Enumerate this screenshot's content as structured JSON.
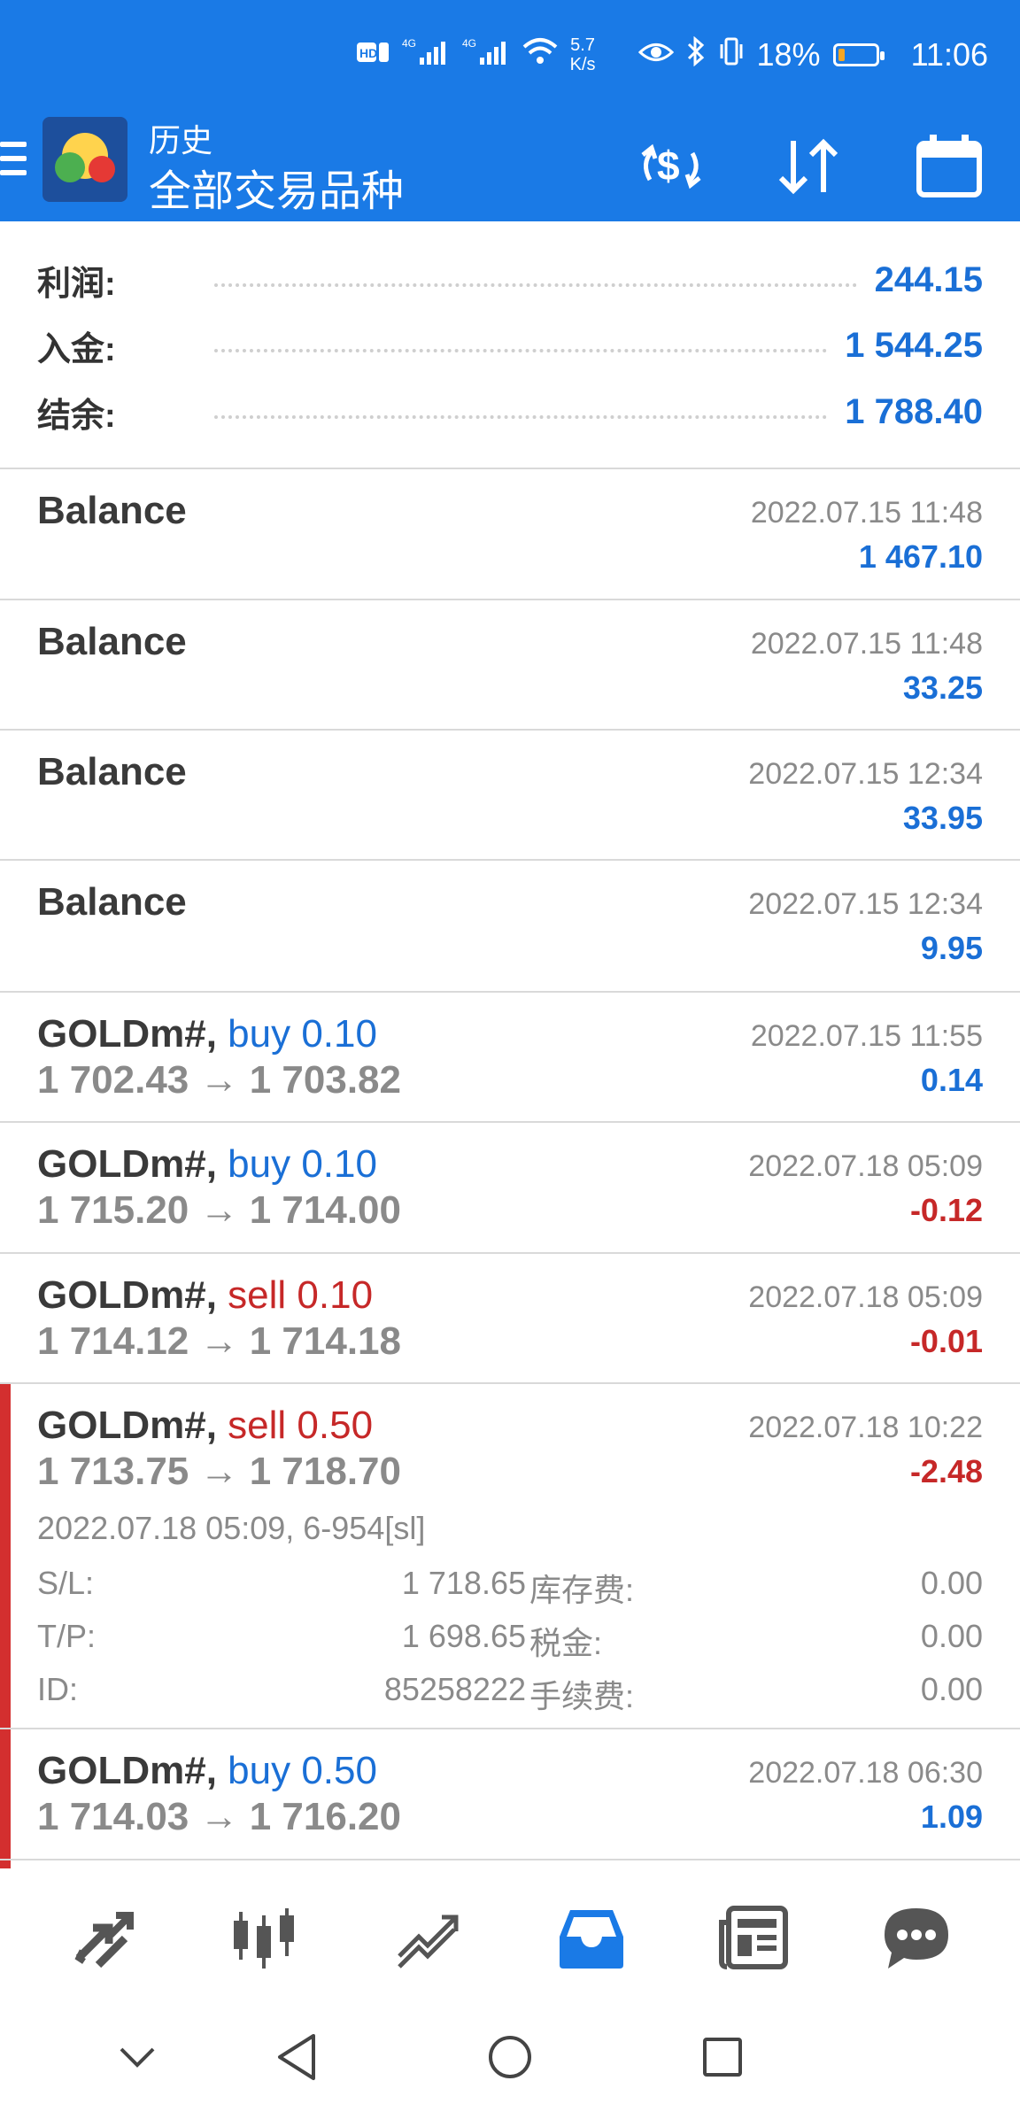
{
  "status_bar": {
    "network_speed": "5.7\nK/s",
    "battery_percent": "18%",
    "battery_level": 0.18,
    "time": "11:06",
    "icons": [
      "hd-icon",
      "sim1-signal-icon",
      "sim2-signal-icon",
      "wifi-icon",
      "eye-icon",
      "bluetooth-icon",
      "vibrate-icon",
      "battery-icon"
    ]
  },
  "appbar": {
    "title": "历史",
    "subtitle": "全部交易品种",
    "actions": [
      "currency-exchange-icon",
      "sort-icon",
      "calendar-icon"
    ]
  },
  "summary": {
    "profit_label": "利润:",
    "profit_value": "244.15",
    "deposit_label": "入金:",
    "deposit_value": "1 544.25",
    "balance_label": "结余:",
    "balance_value": "1 788.40"
  },
  "items": [
    {
      "name": "Balance",
      "date": "2022.07.15 11:48",
      "amount": "1 467.10"
    },
    {
      "name": "Balance",
      "date": "2022.07.15 11:48",
      "amount": "33.25"
    },
    {
      "name": "Balance",
      "date": "2022.07.15 12:34",
      "amount": "33.95"
    },
    {
      "name": "Balance",
      "date": "2022.07.15 12:34",
      "amount": "9.95"
    },
    {
      "symbol": "GOLDm#,",
      "side": "buy 0.10",
      "prices": "1 702.43 → 1 703.82",
      "date": "2022.07.15 11:55",
      "amount": "0.14"
    },
    {
      "symbol": "GOLDm#,",
      "side": "buy 0.10",
      "prices": "1 715.20 → 1 714.00",
      "date": "2022.07.18 05:09",
      "amount": "-0.12"
    },
    {
      "symbol": "GOLDm#,",
      "side": "sell 0.10",
      "prices": "1 714.12 → 1 714.18",
      "date": "2022.07.18 05:09",
      "amount": "-0.01"
    },
    {
      "symbol": "GOLDm#,",
      "side": "sell 0.50",
      "prices": "1 713.75 → 1 718.70",
      "date": "2022.07.18 10:22",
      "amount": "-2.48",
      "detail": {
        "open_info": "2022.07.18 05:09, 6-954[sl]",
        "sl_label": "S/L:",
        "sl_value": "1 718.65",
        "swap_label": "库存费:",
        "swap_value": "0.00",
        "tp_label": "T/P:",
        "tp_value": "1 698.65",
        "tax_label": "税金:",
        "tax_value": "0.00",
        "id_label": "ID:",
        "id_value": "85258222",
        "fee_label": "手续费:",
        "fee_value": "0.00"
      }
    },
    {
      "symbol": "GOLDm#,",
      "side": "buy 0.50",
      "prices": "1 714.03 → 1 716.20",
      "date": "2022.07.18 06:30",
      "amount": "1.09"
    }
  ],
  "bottom_nav": [
    "quotes-icon",
    "chart-icon",
    "trade-icon",
    "history-icon",
    "news-icon",
    "chat-icon"
  ],
  "system_nav": [
    "chevron-down-icon",
    "back-icon",
    "home-icon",
    "recents-icon"
  ],
  "colors": {
    "primary": "#1a7ae6",
    "positive": "#1a6fd6",
    "negative": "#c62828",
    "selected_marker": "#d32f2f"
  }
}
